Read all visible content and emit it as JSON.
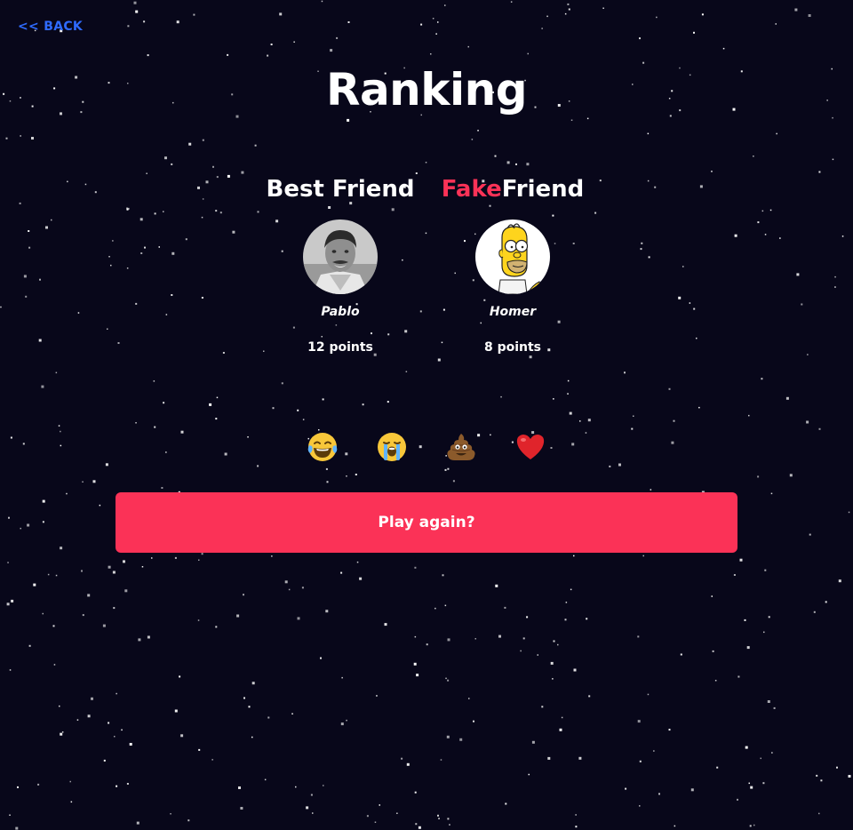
{
  "nav": {
    "back_label": "<< BACK"
  },
  "page": {
    "title": "Ranking"
  },
  "ranking": {
    "best": {
      "heading": "Best Friend",
      "player_name": "Pablo",
      "points_label": "12 points"
    },
    "fake": {
      "heading_accent": "Fake",
      "heading_rest": "Friend",
      "player_name": "Homer",
      "points_label": "8 points"
    }
  },
  "reactions": [
    {
      "icon": "laughing-tears-emoji"
    },
    {
      "icon": "loudly-crying-emoji"
    },
    {
      "icon": "pile-of-poo-emoji"
    },
    {
      "icon": "red-heart-emoji"
    }
  ],
  "actions": {
    "play_again_label": "Play again?"
  },
  "colors": {
    "background": "#08071a",
    "accent": "#fb3257",
    "link": "#2f6bff",
    "text": "#ffffff"
  }
}
